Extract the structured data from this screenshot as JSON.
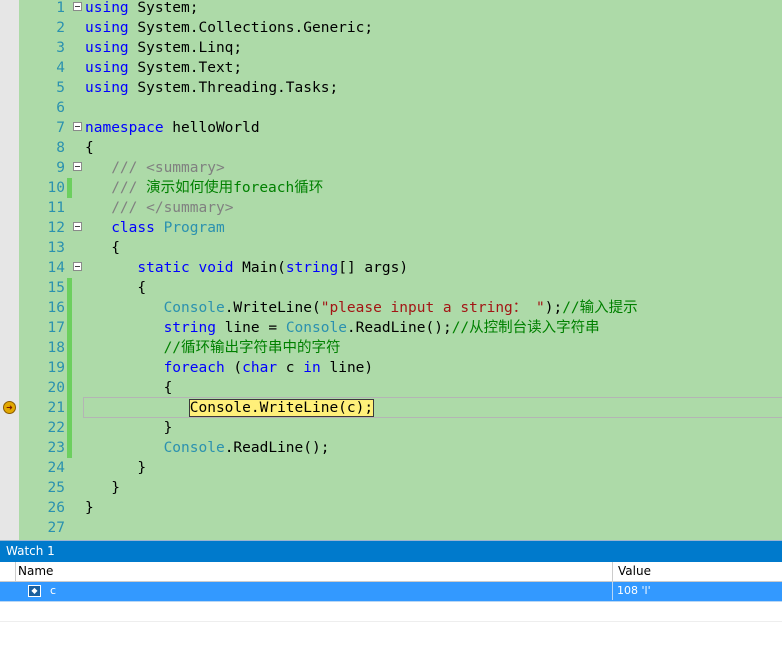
{
  "editor": {
    "lines": [
      {
        "n": "1",
        "fold": true,
        "segs": [
          [
            "kw",
            "using"
          ],
          [
            "",
            "&nbsp;System;"
          ]
        ]
      },
      {
        "n": "2",
        "segs": [
          [
            "kw",
            "using"
          ],
          [
            "",
            "&nbsp;System.Collections.Generic;"
          ]
        ]
      },
      {
        "n": "3",
        "segs": [
          [
            "kw",
            "using"
          ],
          [
            "",
            "&nbsp;System.Linq;"
          ]
        ]
      },
      {
        "n": "4",
        "segs": [
          [
            "kw",
            "using"
          ],
          [
            "",
            "&nbsp;System.Text;"
          ]
        ]
      },
      {
        "n": "5",
        "segs": [
          [
            "kw",
            "using"
          ],
          [
            "",
            "&nbsp;System.Threading.Tasks;"
          ]
        ]
      },
      {
        "n": "6",
        "segs": []
      },
      {
        "n": "7",
        "fold": true,
        "segs": [
          [
            "kw",
            "namespace"
          ],
          [
            "",
            "&nbsp;helloWorld"
          ]
        ]
      },
      {
        "n": "8",
        "segs": [
          [
            "",
            "{"
          ]
        ]
      },
      {
        "n": "9",
        "fold": true,
        "segs": [
          [
            "",
            "&nbsp;&nbsp;&nbsp;"
          ],
          [
            "xd",
            "/// &lt;summary&gt;"
          ]
        ]
      },
      {
        "n": "10",
        "chg": true,
        "segs": [
          [
            "",
            "&nbsp;&nbsp;&nbsp;"
          ],
          [
            "xd",
            "///"
          ],
          [
            "cm",
            "&nbsp;演示如何使用foreach循环"
          ]
        ]
      },
      {
        "n": "11",
        "segs": [
          [
            "",
            "&nbsp;&nbsp;&nbsp;"
          ],
          [
            "xd",
            "/// &lt;/summary&gt;"
          ]
        ]
      },
      {
        "n": "12",
        "fold": true,
        "segs": [
          [
            "",
            "&nbsp;&nbsp;&nbsp;"
          ],
          [
            "kw",
            "class"
          ],
          [
            "",
            "&nbsp;"
          ],
          [
            "ty",
            "Program"
          ]
        ]
      },
      {
        "n": "13",
        "segs": [
          [
            "",
            "&nbsp;&nbsp;&nbsp;{"
          ]
        ]
      },
      {
        "n": "14",
        "fold": true,
        "segs": [
          [
            "",
            "&nbsp;&nbsp;&nbsp;&nbsp;&nbsp;&nbsp;"
          ],
          [
            "kw",
            "static"
          ],
          [
            "",
            "&nbsp;"
          ],
          [
            "kw",
            "void"
          ],
          [
            "",
            "&nbsp;Main("
          ],
          [
            "kw",
            "string"
          ],
          [
            "",
            "[] args)"
          ]
        ]
      },
      {
        "n": "15",
        "chg": true,
        "segs": [
          [
            "",
            "&nbsp;&nbsp;&nbsp;&nbsp;&nbsp;&nbsp;{"
          ]
        ]
      },
      {
        "n": "16",
        "chg": true,
        "segs": [
          [
            "",
            "&nbsp;&nbsp;&nbsp;&nbsp;&nbsp;&nbsp;&nbsp;&nbsp;&nbsp;"
          ],
          [
            "ty",
            "Console"
          ],
          [
            "",
            ".WriteLine("
          ],
          [
            "st",
            "\"please input a string： \""
          ],
          [
            "",
            ");"
          ],
          [
            "cm",
            "//输入提示"
          ]
        ]
      },
      {
        "n": "17",
        "chg": true,
        "segs": [
          [
            "",
            "&nbsp;&nbsp;&nbsp;&nbsp;&nbsp;&nbsp;&nbsp;&nbsp;&nbsp;"
          ],
          [
            "kw",
            "string"
          ],
          [
            "",
            "&nbsp;line = "
          ],
          [
            "ty",
            "Console"
          ],
          [
            "",
            ".ReadLine();"
          ],
          [
            "cm",
            "//从控制台读入字符串"
          ]
        ]
      },
      {
        "n": "18",
        "chg": true,
        "segs": [
          [
            "",
            "&nbsp;&nbsp;&nbsp;&nbsp;&nbsp;&nbsp;&nbsp;&nbsp;&nbsp;"
          ],
          [
            "cm",
            "//循环输出字符串中的字符"
          ]
        ]
      },
      {
        "n": "19",
        "chg": true,
        "segs": [
          [
            "",
            "&nbsp;&nbsp;&nbsp;&nbsp;&nbsp;&nbsp;&nbsp;&nbsp;&nbsp;"
          ],
          [
            "kw",
            "foreach"
          ],
          [
            "",
            "&nbsp;("
          ],
          [
            "kw",
            "char"
          ],
          [
            "",
            "&nbsp;c&nbsp;"
          ],
          [
            "kw",
            "in"
          ],
          [
            "",
            "&nbsp;line)"
          ]
        ]
      },
      {
        "n": "20",
        "chg": true,
        "segs": [
          [
            "",
            "&nbsp;&nbsp;&nbsp;&nbsp;&nbsp;&nbsp;&nbsp;&nbsp;&nbsp;{"
          ]
        ]
      },
      {
        "n": "21",
        "chg": true,
        "segs": [
          [
            "",
            "&nbsp;&nbsp;&nbsp;&nbsp;&nbsp;&nbsp;&nbsp;&nbsp;&nbsp;&nbsp;&nbsp;&nbsp;"
          ],
          [
            "hl",
            "Console.WriteLine(c);"
          ]
        ]
      },
      {
        "n": "22",
        "chg": true,
        "segs": [
          [
            "",
            "&nbsp;&nbsp;&nbsp;&nbsp;&nbsp;&nbsp;&nbsp;&nbsp;&nbsp;}"
          ]
        ]
      },
      {
        "n": "23",
        "chg": true,
        "segs": [
          [
            "",
            "&nbsp;&nbsp;&nbsp;&nbsp;&nbsp;&nbsp;&nbsp;&nbsp;&nbsp;"
          ],
          [
            "ty",
            "Console"
          ],
          [
            "",
            ".ReadLine();"
          ]
        ]
      },
      {
        "n": "24",
        "segs": [
          [
            "",
            "&nbsp;&nbsp;&nbsp;&nbsp;&nbsp;&nbsp;}"
          ]
        ]
      },
      {
        "n": "25",
        "segs": [
          [
            "",
            "&nbsp;&nbsp;&nbsp;}"
          ]
        ]
      },
      {
        "n": "26",
        "segs": [
          [
            "",
            "}"
          ]
        ]
      },
      {
        "n": "27",
        "segs": []
      }
    ]
  },
  "watch": {
    "title": "Watch 1",
    "col_name": "Name",
    "col_value": "Value",
    "rows": [
      {
        "name": "c",
        "value": "108 'l'"
      }
    ]
  },
  "icons": {
    "breakpoint": "current-statement-arrow-icon",
    "variable": "local-variable-icon"
  }
}
